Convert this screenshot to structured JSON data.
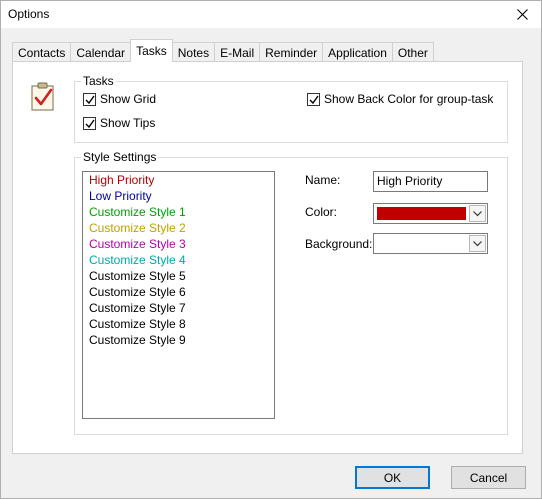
{
  "window": {
    "title": "Options"
  },
  "tabs": [
    "Contacts",
    "Calendar",
    "Tasks",
    "Notes",
    "E-Mail",
    "Reminder",
    "Application",
    "Other"
  ],
  "active_tab": "Tasks",
  "tasks_group": {
    "label": "Tasks",
    "show_grid": {
      "label": "Show Grid",
      "checked": true
    },
    "show_tips": {
      "label": "Show Tips",
      "checked": true
    },
    "show_back_color": {
      "label": "Show Back Color for group-task",
      "checked": true
    }
  },
  "style_settings": {
    "label": "Style Settings",
    "items": [
      {
        "label": "High Priority",
        "color": "#b00000"
      },
      {
        "label": "Low Priority",
        "color": "#0000a0"
      },
      {
        "label": "Customize Style 1",
        "color": "#00a000"
      },
      {
        "label": "Customize Style 2",
        "color": "#c0a000"
      },
      {
        "label": "Customize Style 3",
        "color": "#b000b0"
      },
      {
        "label": "Customize Style 4",
        "color": "#00a8a8"
      },
      {
        "label": "Customize Style 5",
        "color": "#000000"
      },
      {
        "label": "Customize Style 6",
        "color": "#000000"
      },
      {
        "label": "Customize Style 7",
        "color": "#000000"
      },
      {
        "label": "Customize Style 8",
        "color": "#000000"
      },
      {
        "label": "Customize Style 9",
        "color": "#000000"
      }
    ],
    "name_label": "Name:",
    "name_value": "High Priority",
    "color_label": "Color:",
    "color_value": "#c00000",
    "background_label": "Background:"
  },
  "buttons": {
    "ok": "OK",
    "cancel": "Cancel"
  }
}
